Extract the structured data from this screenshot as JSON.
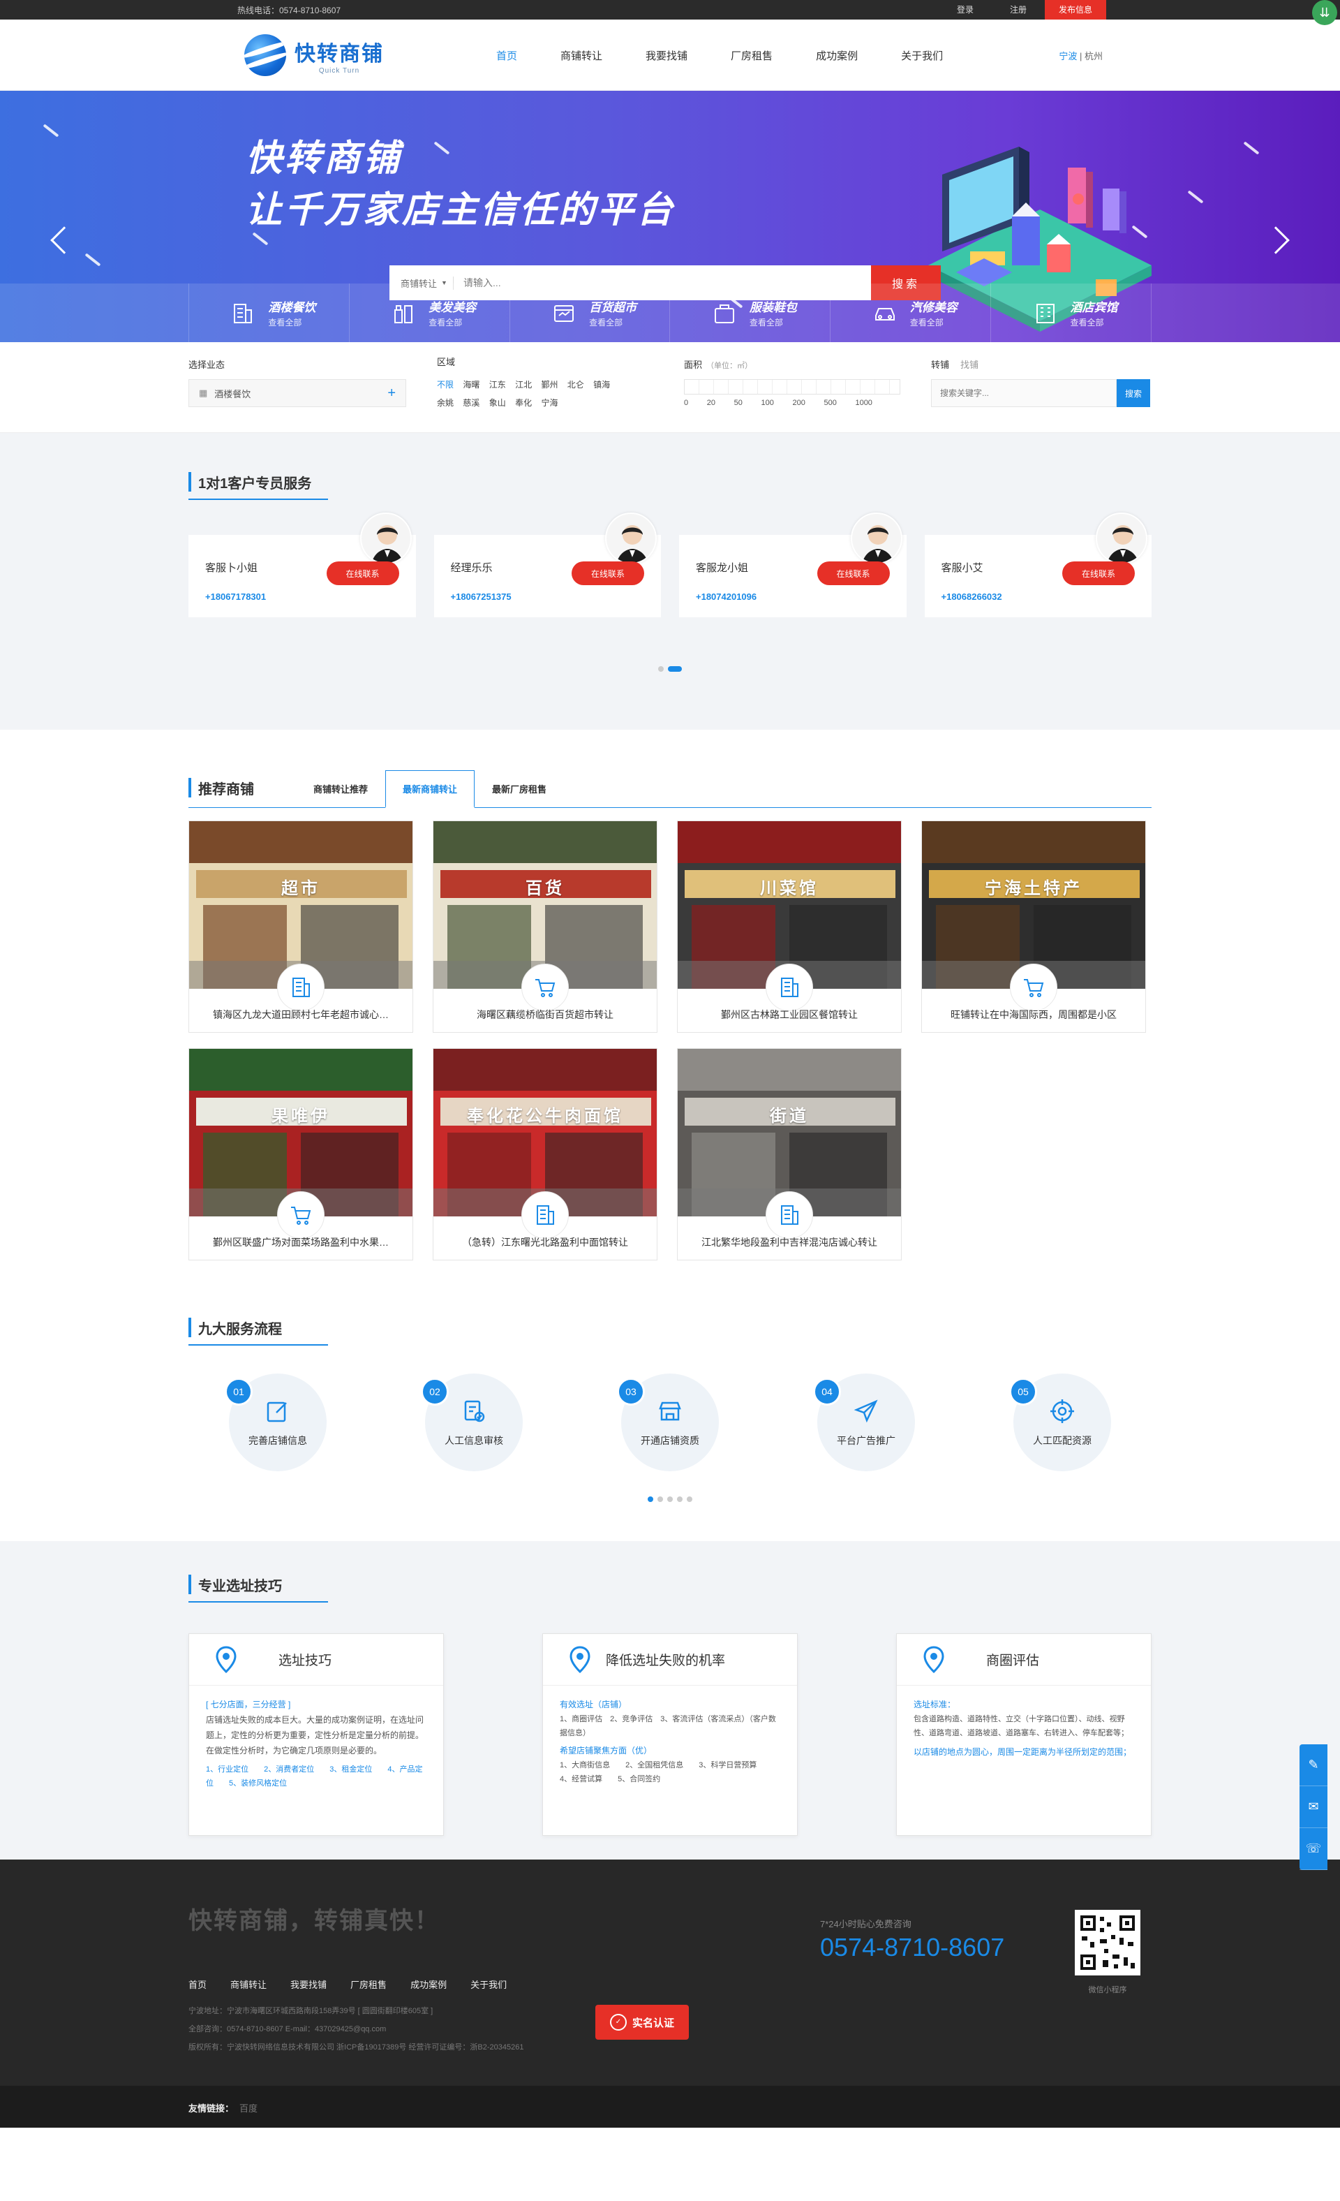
{
  "topbar": {
    "hotline": "热线电话：0574-8710-8607",
    "login": "登录",
    "register": "注册",
    "publish": "发布信息"
  },
  "header": {
    "logo_cn": "快转商铺",
    "logo_en": "Quick Turn",
    "nav": [
      "首页",
      "商铺转让",
      "我要找铺",
      "厂房租售",
      "成功案例",
      "关于我们"
    ],
    "city_current": "宁波",
    "city_sep": " | ",
    "city_other": "杭州"
  },
  "banner": {
    "line1": "快转商铺",
    "line2": "让千万家店主信任的平台",
    "search_type": "商铺转让",
    "search_placeholder": "请输入...",
    "search_button": "搜索",
    "categories": [
      {
        "title": "酒楼餐饮",
        "sub": "查看全部",
        "icon": "building-icon"
      },
      {
        "title": "美发美容",
        "sub": "查看全部",
        "icon": "cosmetics-icon"
      },
      {
        "title": "百货超市",
        "sub": "查看全部",
        "icon": "store-icon"
      },
      {
        "title": "服装鞋包",
        "sub": "查看全部",
        "icon": "bag-icon"
      },
      {
        "title": "汽修美容",
        "sub": "查看全部",
        "icon": "car-icon"
      },
      {
        "title": "酒店宾馆",
        "sub": "查看全部",
        "icon": "hotel-icon"
      }
    ]
  },
  "filter": {
    "biz_label": "选择业态",
    "biz_value": "酒楼餐饮",
    "area_label": "区域",
    "areas": [
      "不限",
      "海曙",
      "江东",
      "江北",
      "鄞州",
      "北仑",
      "镇海",
      "余姚",
      "慈溪",
      "象山",
      "奉化",
      "宁海"
    ],
    "size_label": "面积",
    "size_unit": "（单位：㎡）",
    "size_marks": [
      "0",
      "20",
      "50",
      "100",
      "200",
      "500",
      "1000"
    ],
    "tab_transfer": "转铺",
    "tab_find": "找铺",
    "kw_placeholder": "搜索关键字...",
    "kw_button": "搜索"
  },
  "service": {
    "title": "1对1客户专员服务",
    "contact": "在线联系",
    "agents": [
      {
        "name": "客服卜小姐",
        "phone": "+18067178301"
      },
      {
        "name": "经理乐乐",
        "phone": "+18067251375"
      },
      {
        "name": "客服龙小姐",
        "phone": "+18074201096"
      },
      {
        "name": "客服小艾",
        "phone": "+18068266032"
      }
    ]
  },
  "recommend": {
    "title": "推荐商铺",
    "tabs": [
      "商铺转让推荐",
      "最新商铺转让",
      "最新厂房租售"
    ],
    "items": [
      {
        "caption": "镇海区九龙大道田顾村七年老超市诚心…",
        "scene": "超市",
        "icon": "building-icon"
      },
      {
        "caption": "海曙区藕缆桥临街百货超市转让",
        "scene": "百货",
        "icon": "cart-icon"
      },
      {
        "caption": "鄞州区古林路工业园区餐馆转让",
        "scene": "川菜馆",
        "icon": "building-icon"
      },
      {
        "caption": "旺铺转让在中海国际西，周围都是小区",
        "scene": "宁海土特产",
        "icon": "cart-icon"
      },
      {
        "caption": "鄞州区联盛广场对面菜场路盈利中水果…",
        "scene": "果唯伊",
        "icon": "cart-icon"
      },
      {
        "caption": "（急转）江东曙光北路盈利中面馆转让",
        "scene": "奉化花公牛肉面馆",
        "icon": "building-icon"
      },
      {
        "caption": "江北繁华地段盈利中吉祥混沌店诚心转让",
        "scene": "街道",
        "icon": "building-icon"
      }
    ]
  },
  "process": {
    "title": "九大服务流程",
    "steps": [
      {
        "num": "01",
        "label": "完善店铺信息"
      },
      {
        "num": "02",
        "label": "人工信息审核"
      },
      {
        "num": "03",
        "label": "开通店铺资质"
      },
      {
        "num": "04",
        "label": "平台广告推广"
      },
      {
        "num": "05",
        "label": "人工匹配资源"
      }
    ]
  },
  "tips": {
    "title": "专业选址技巧",
    "cards": [
      {
        "title": "选址技巧",
        "head": "[ 七分店面，三分经营 ]",
        "body": "店铺选址失败的成本巨大。大量的成功案例证明，在选址问题上，定性的分析更为重要，定性分析是定量分析的前提。在做定性分析时，为它确定几项原则是必要的。",
        "list": "1、行业定位　　2、消费者定位　　3、租金定位　　4、产品定位　　5、装修风格定位"
      },
      {
        "title": "降低选址失败的机率",
        "head": "有效选址（店铺）",
        "body": "1、商圈评估　2、竞争评估　3、客流评估（客流采点）（客户数据信息）",
        "head2": "希望店铺聚焦方面（优）",
        "list": "1、大商街信息　　2、全国租凭信息　　3、科学日营预算　　4、经营试算　　5、合同签约"
      },
      {
        "title": "商圈评估",
        "head": "选址标准：",
        "body": "包含道路构造、道路特性、立交（十字路口位置）、动线、视野性、道路弯道、道路坡道、道路塞车、右转进入、停车配套等；",
        "list": "以店铺的地点为圆心，周围一定距离为半径所划定的范围；"
      }
    ]
  },
  "footer": {
    "slogan": "快转商铺，转铺真快！",
    "nav": [
      "首页",
      "商铺转让",
      "我要找铺",
      "厂房租售",
      "成功案例",
      "关于我们"
    ],
    "addr": "宁波地址：宁波市海曙区环城西路南段158弄39号 [ 圆圆街翻印楼605室 ]",
    "contact": "全部咨询：0574-8710-8607  E-mail：437029425@qq.com",
    "copyright": "版权所有：宁波快转网络信息技术有限公司  浙ICP备19017389号  经营许可证编号：浙B2-20345261",
    "hotline_label": "7*24小时贴心免费咨询",
    "hotline": "0574-8710-8607",
    "qr_caption": "微信小程序",
    "realname": "实名认证",
    "friend_label": "友情链接：",
    "friend_link": "百度"
  },
  "colors": {
    "accent": "#1a8ae6",
    "primary_red": "#e63027",
    "banner_start": "#3d6fe0",
    "banner_end": "#5b1dbd"
  }
}
